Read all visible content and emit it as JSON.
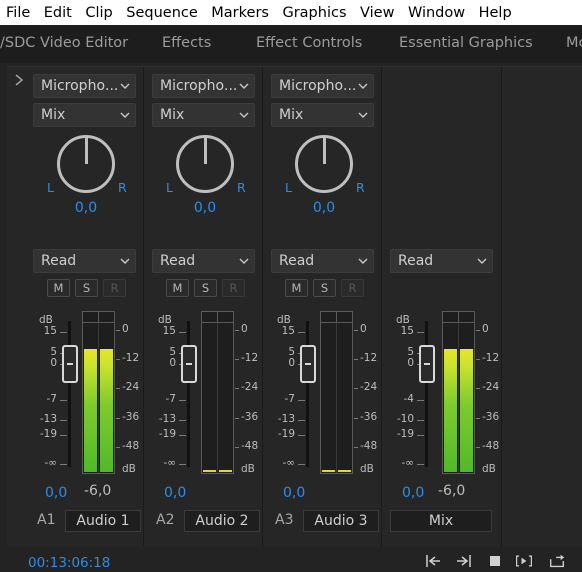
{
  "menu": [
    "File",
    "Edit",
    "Clip",
    "Sequence",
    "Markers",
    "Graphics",
    "View",
    "Window",
    "Help"
  ],
  "tabs": [
    "/SDC Video Editor",
    "Effects",
    "Effect Controls",
    "Essential Graphics",
    "Mc"
  ],
  "colors": {
    "accent_blue": "#2d8ceb",
    "meter_green": "#52b82a",
    "meter_yellow": "#e5e52c",
    "panel_bg": "#262626"
  },
  "tracks": [
    {
      "input": "Microphо...",
      "mode": "Mix",
      "pan_left": "L",
      "pan_right": "R",
      "pan_value": "0,0",
      "automation": "Read",
      "mute": "M",
      "solo": "S",
      "record": "R",
      "volume": "0,0",
      "peak": "-6,0",
      "id": "A1",
      "name": "Audio 1",
      "meter_level": 0.82
    },
    {
      "input": "Microphо...",
      "mode": "Mix",
      "pan_left": "L",
      "pan_right": "R",
      "pan_value": "0,0",
      "automation": "Read",
      "mute": "M",
      "solo": "S",
      "record": "R",
      "volume": "0,0",
      "peak": "",
      "id": "A2",
      "name": "Audio 2",
      "meter_level": 0
    },
    {
      "input": "Microphо...",
      "mode": "Mix",
      "pan_left": "L",
      "pan_right": "R",
      "pan_value": "0,0",
      "automation": "Read",
      "mute": "M",
      "solo": "S",
      "record": "R",
      "volume": "0,0",
      "peak": "",
      "id": "A3",
      "name": "Audio 3",
      "meter_level": 0
    }
  ],
  "master": {
    "automation": "Read",
    "volume": "0,0",
    "peak": "-6,0",
    "name": "Mix",
    "meter_level": 0.82
  },
  "fader_scale": {
    "unit": "dB",
    "labels": [
      "15",
      "5",
      "0",
      "-7",
      "-13",
      "-19",
      "-∞"
    ]
  },
  "master_fader_scale": {
    "unit": "dB",
    "labels": [
      "15",
      "5",
      "0",
      "-4",
      "-10",
      "-19",
      "-∞"
    ]
  },
  "meter_scale": {
    "unit": "dB",
    "labels": [
      "0",
      "-12",
      "-24",
      "-36",
      "-48"
    ]
  },
  "footer": {
    "timecode": "00:13:06:18"
  },
  "transport_icons": [
    "go-to-in-icon",
    "go-to-out-icon",
    "stop-icon",
    "play-in-to-out-icon",
    "loop-icon"
  ]
}
